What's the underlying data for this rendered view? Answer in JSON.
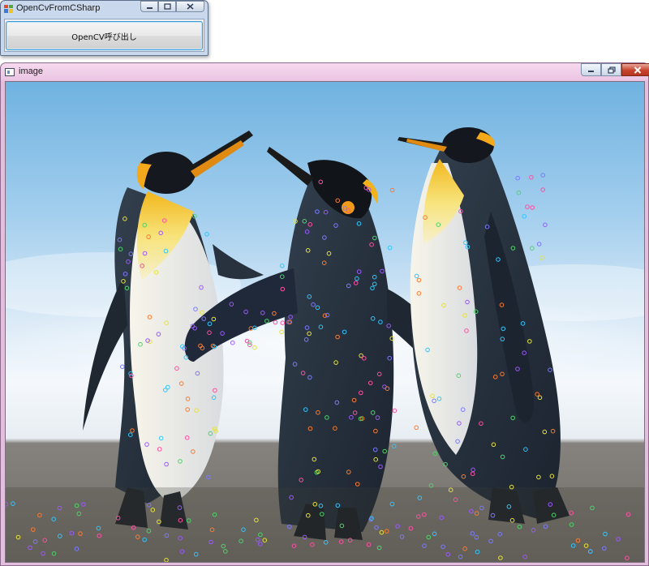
{
  "app_window": {
    "title": "OpenCvFromCSharp",
    "button_label": "OpenCV呼び出し",
    "caption_buttons": [
      "minimize",
      "restore",
      "close"
    ]
  },
  "image_window": {
    "title": "image",
    "caption_buttons": [
      "minimize",
      "restore",
      "close"
    ],
    "image": {
      "subject": "three emperor penguins on a beach with keypoint circles",
      "keypoint_colors": [
        "#9b59ff",
        "#4fd36b",
        "#ff7a2e",
        "#2ec7ff",
        "#ff4fa3",
        "#e6e23a",
        "#7a7aff"
      ]
    }
  },
  "icons": {
    "app_icon": "form-app-icon",
    "image_icon": "image-window-icon",
    "minimize": "minimize-icon",
    "restore": "restore-icon",
    "close": "close-icon"
  }
}
